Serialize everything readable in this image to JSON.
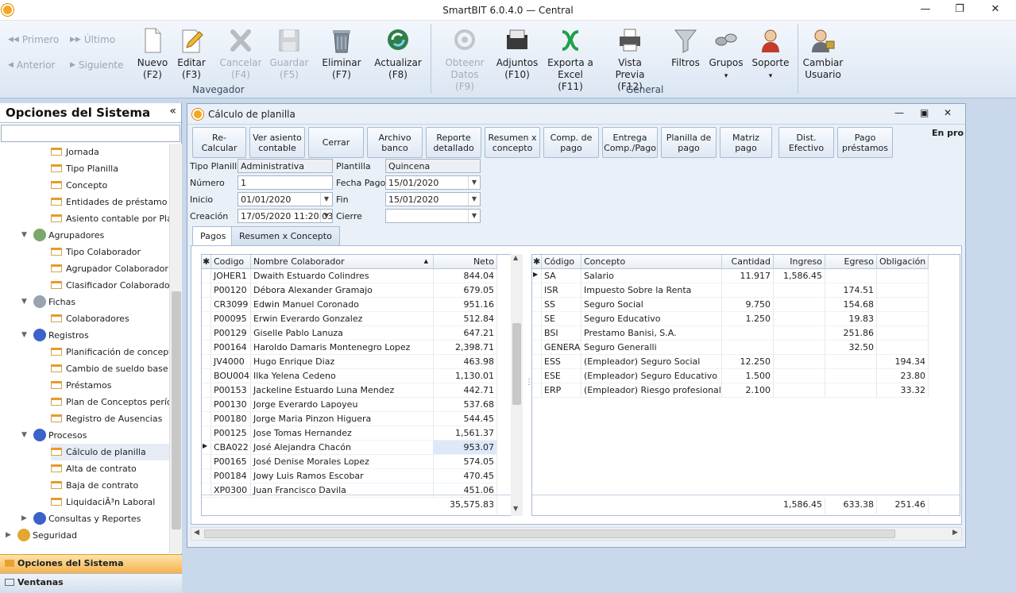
{
  "window": {
    "title": "SmartBIT 6.0.4.0 — Central",
    "minimize": "—",
    "restore": "❐",
    "close": "✕"
  },
  "ribbon": {
    "nav": {
      "first": "Primero",
      "last": "Último",
      "prev": "Anterior",
      "next": "Siguiente"
    },
    "buttons": [
      {
        "l1": "Nuevo",
        "l2": "(F2)",
        "icon": "new-document-icon"
      },
      {
        "l1": "Editar",
        "l2": "(F3)",
        "icon": "edit-icon"
      },
      {
        "l1": "Cancelar",
        "l2": "(F4)",
        "icon": "cancel-icon"
      },
      {
        "l1": "Guardar",
        "l2": "(F5)",
        "icon": "save-icon"
      },
      {
        "l1": "Eliminar",
        "l2": "(F7)",
        "icon": "trash-icon"
      },
      {
        "l1": "Actualizar",
        "l2": "(F8)",
        "icon": "refresh-icon"
      },
      {
        "l1": "Obteenr",
        "l2": "Datos (F9)",
        "icon": "get-data-icon"
      },
      {
        "l1": "Adjuntos",
        "l2": "(F10)",
        "icon": "attachments-icon"
      },
      {
        "l1": "Exporta a",
        "l2": "Excel (F11)",
        "icon": "excel-export-icon"
      },
      {
        "l1": "Vista Previa",
        "l2": "(F12)",
        "icon": "print-preview-icon"
      },
      {
        "l1": "Filtros",
        "l2": "",
        "icon": "filter-icon"
      },
      {
        "l1": "Grupos",
        "l2": "▾",
        "icon": "groups-icon"
      },
      {
        "l1": "Soporte",
        "l2": "▾",
        "icon": "support-icon"
      },
      {
        "l1": "Cambiar",
        "l2": "Usuario",
        "icon": "change-user-icon"
      }
    ],
    "groups": {
      "navegador": "Navegador",
      "general": "General"
    }
  },
  "sidebar": {
    "title": "Opciones del Sistema",
    "collapse": "«",
    "tree": [
      {
        "label": "Jornada",
        "kind": "leaf"
      },
      {
        "label": "Tipo Planilla",
        "kind": "leaf"
      },
      {
        "label": "Concepto",
        "kind": "leaf"
      },
      {
        "label": "Entidades de préstamo",
        "kind": "leaf"
      },
      {
        "label": "Asiento contable por Planti",
        "kind": "leaf"
      },
      {
        "label": "Agrupadores",
        "kind": "group"
      },
      {
        "label": "Tipo Colaborador",
        "kind": "leaf"
      },
      {
        "label": "Agrupador Colaborador",
        "kind": "leaf"
      },
      {
        "label": "Clasificador Colaborador",
        "kind": "leaf"
      },
      {
        "label": "Fichas",
        "kind": "group"
      },
      {
        "label": "Colaboradores",
        "kind": "leaf"
      },
      {
        "label": "Registros",
        "kind": "group"
      },
      {
        "label": "Planificación de conceptos",
        "kind": "leaf"
      },
      {
        "label": "Cambio de sueldo base",
        "kind": "leaf"
      },
      {
        "label": "Préstamos",
        "kind": "leaf"
      },
      {
        "label": "Plan de Conceptos período",
        "kind": "leaf"
      },
      {
        "label": "Registro de Ausencias",
        "kind": "leaf"
      },
      {
        "label": "Procesos",
        "kind": "group"
      },
      {
        "label": "Cálculo de planilla",
        "kind": "leaf"
      },
      {
        "label": "Alta de contrato",
        "kind": "leaf"
      },
      {
        "label": "Baja de contrato",
        "kind": "leaf"
      },
      {
        "label": "LiquidaciÃ³n Laboral",
        "kind": "leaf"
      },
      {
        "label": "Consultas y Reportes",
        "kind": "group"
      },
      {
        "label": "Seguridad",
        "kind": "root"
      }
    ],
    "bottom": {
      "options": "Opciones del Sistema",
      "windows": "Ventanas"
    }
  },
  "doc": {
    "title": "Cálculo de planilla",
    "toolbar": [
      "Re-Calcular",
      "Ver asiento contable",
      "Cerrar",
      "Archivo banco",
      "Reporte detallado",
      "Resumen x concepto",
      "Comp. de pago",
      "Entrega Comp./Pago",
      "Planilla de pago",
      "Matriz pago",
      "Dist. Efectivo",
      "Pago préstamos"
    ],
    "status": "En pro",
    "form": {
      "tipo_planilla_label": "Tipo Planilla",
      "tipo_planilla": "Administrativa",
      "plantilla_label": "Plantilla",
      "plantilla": "Quincena",
      "numero_label": "Número",
      "numero": "1",
      "fecha_pago_label": "Fecha Pago",
      "fecha_pago": "15/01/2020",
      "inicio_label": "Inicio",
      "inicio": "01/01/2020",
      "fin_label": "Fin",
      "fin": "15/01/2020",
      "creacion_label": "Creación",
      "creacion": "17/05/2020 11:20:03",
      "cierre_label": "Cierre",
      "cierre": ""
    },
    "tabs": [
      "Pagos",
      "Resumen x Concepto"
    ],
    "pagos": {
      "headers": [
        "Codigo",
        "Nombre Colaborador",
        "Neto"
      ],
      "rows": [
        [
          "JOHER1",
          "Dwaith Estuardo Colindres",
          "844.04"
        ],
        [
          "P00120",
          "Débora Alexander Gramajo",
          "679.05"
        ],
        [
          "CR3099",
          "Edwin Manuel Coronado",
          "951.16"
        ],
        [
          "P00095",
          "Erwin Everardo Gonzalez",
          "512.84"
        ],
        [
          "P00129",
          "Giselle Pablo Lanuza",
          "647.21"
        ],
        [
          "P00164",
          "Haroldo Damaris Montenegro Lopez",
          "2,398.71"
        ],
        [
          "JV4000",
          "Hugo Enrique Diaz",
          "463.98"
        ],
        [
          "BOU004",
          "Ilka Yelena Cedeno",
          "1,130.01"
        ],
        [
          "P00153",
          "Jackeline Estuardo Luna Mendez",
          "442.71"
        ],
        [
          "P00130",
          "Jorge Everardo Lapoyeu",
          "537.68"
        ],
        [
          "P00180",
          "Jorge Maria Pinzon Higuera",
          "544.45"
        ],
        [
          "P00125",
          "Jose Tomas Hernandez",
          "1,561.37"
        ],
        [
          "CBA022",
          "José Alejandra Chacón",
          "953.07"
        ],
        [
          "P00165",
          "José Denise Morales Lopez",
          "574.05"
        ],
        [
          "P00184",
          "Jowy Luis Ramos Escobar",
          "470.45"
        ],
        [
          "XP0300",
          "Juan Francisco Davila",
          "451.06"
        ]
      ],
      "total": "35,575.83"
    },
    "conceptos": {
      "headers": [
        "Código",
        "Concepto",
        "Cantidad",
        "Ingreso",
        "Egreso",
        "Obligación"
      ],
      "rows": [
        [
          "SA",
          "Salario",
          "11.917",
          "1,586.45",
          "",
          ""
        ],
        [
          "ISR",
          "Impuesto Sobre la Renta",
          "",
          "",
          "174.51",
          ""
        ],
        [
          "SS",
          "Seguro Social",
          "9.750",
          "",
          "154.68",
          ""
        ],
        [
          "SE",
          "Seguro Educativo",
          "1.250",
          "",
          "19.83",
          ""
        ],
        [
          "BSI",
          "Prestamo Banisi, S.A.",
          "",
          "",
          "251.86",
          ""
        ],
        [
          "GENERALI",
          "Seguro Generalli",
          "",
          "",
          "32.50",
          ""
        ],
        [
          "ESS",
          "(Empleador) Seguro Social",
          "12.250",
          "",
          "",
          "194.34"
        ],
        [
          "ESE",
          "(Empleador) Seguro Educativo",
          "1.500",
          "",
          "",
          "23.80"
        ],
        [
          "ERP",
          "(Empleador) Riesgo profesional",
          "2.100",
          "",
          "",
          "33.32"
        ]
      ],
      "totals": [
        "1,586.45",
        "633.38",
        "251.46"
      ]
    }
  }
}
